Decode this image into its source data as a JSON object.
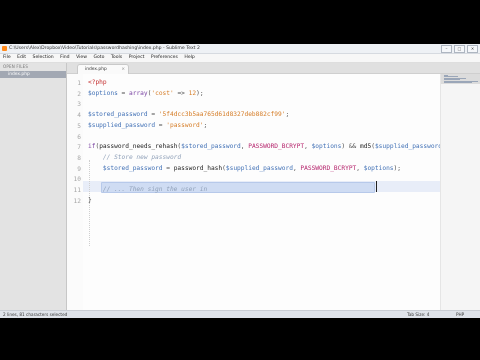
{
  "window": {
    "title": "C:\\Users\\Alex\\Dropbox\\Video\\Tutorials\\passwordhashing\\index.php - Sublime Text 2",
    "controls": [
      "–",
      "□",
      "✕"
    ]
  },
  "menu": [
    "File",
    "Edit",
    "Selection",
    "Find",
    "View",
    "Goto",
    "Tools",
    "Project",
    "Preferences",
    "Help"
  ],
  "sidebar": {
    "header": "OPEN FILES",
    "files": [
      "index.php"
    ]
  },
  "tabs": [
    {
      "label": "index.php",
      "close": "×"
    }
  ],
  "editor": {
    "line_numbers": [
      "1",
      "2",
      "3",
      "4",
      "5",
      "6",
      "7",
      "8",
      "9",
      "10",
      "11",
      "12"
    ],
    "lines": [
      [
        [
          "tag",
          "<?php"
        ]
      ],
      [
        [
          "var",
          "$options"
        ],
        [
          "op",
          " = "
        ],
        [
          "kw",
          "array"
        ],
        [
          "op",
          "("
        ],
        [
          "str",
          "'cost'"
        ],
        [
          "op",
          " => "
        ],
        [
          "str",
          "12"
        ],
        [
          "op",
          ");"
        ]
      ],
      [],
      [
        [
          "var",
          "$stored_password"
        ],
        [
          "op",
          " = "
        ],
        [
          "str",
          "'5f4dcc3b5aa765d61d8327deb882cf99'"
        ],
        [
          "op",
          ";"
        ]
      ],
      [
        [
          "var",
          "$supplied_password"
        ],
        [
          "op",
          " = "
        ],
        [
          "str",
          "'password'"
        ],
        [
          "op",
          ";"
        ]
      ],
      [],
      [
        [
          "kw",
          "if"
        ],
        [
          "op",
          "("
        ],
        [
          "fn",
          "password_needs_rehash"
        ],
        [
          "op",
          "("
        ],
        [
          "var",
          "$stored_password"
        ],
        [
          "op",
          ", "
        ],
        [
          "const",
          "PASSWORD_BCRYPT"
        ],
        [
          "op",
          ", "
        ],
        [
          "var",
          "$options"
        ],
        [
          "op",
          ") && "
        ],
        [
          "fn",
          "md5"
        ],
        [
          "op",
          "("
        ],
        [
          "var",
          "$supplied_password"
        ]
      ],
      [
        [
          "op",
          "    "
        ],
        [
          "com",
          "// Store new password"
        ]
      ],
      [
        [
          "op",
          "    "
        ],
        [
          "var",
          "$stored_password"
        ],
        [
          "op",
          " = "
        ],
        [
          "fn",
          "password_hash"
        ],
        [
          "op",
          "("
        ],
        [
          "var",
          "$supplied_password"
        ],
        [
          "op",
          ", "
        ],
        [
          "const",
          "PASSWORD_BCRYPT"
        ],
        [
          "op",
          ", "
        ],
        [
          "var",
          "$options"
        ],
        [
          "op",
          ");"
        ]
      ],
      [],
      [
        [
          "op",
          "    "
        ],
        [
          "com",
          "// ... Then sign the user in"
        ]
      ],
      [
        [
          "op",
          "}"
        ]
      ]
    ]
  },
  "status": {
    "left": "2 lines, 81 characters selected",
    "tab_size": "Tab Size: 4",
    "syntax": "PHP"
  }
}
